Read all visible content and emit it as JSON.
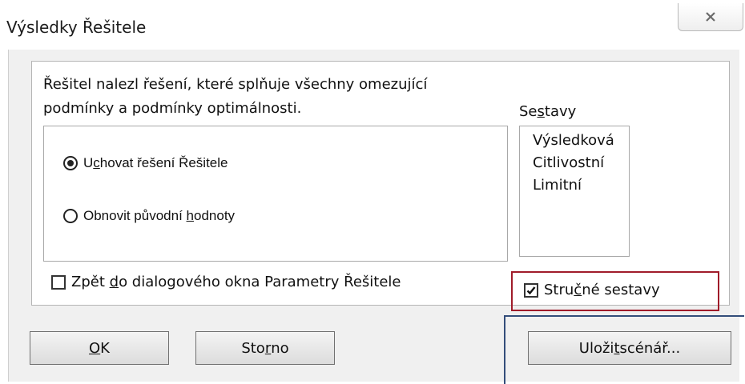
{
  "window": {
    "title": "Výsledky Řešitele"
  },
  "message": {
    "line1": "Řešitel nalezl řešení, které splňuje všechny omezující",
    "line2": "podmínky a podmínky optimálnosti."
  },
  "options": {
    "keep": {
      "pre": "U",
      "mnemonic": "c",
      "post": "hovat řešení Řešitele",
      "selected": true
    },
    "restore": {
      "pre": "Obnovit původní ",
      "mnemonic": "h",
      "post": "odnoty",
      "selected": false
    }
  },
  "reports": {
    "label_pre": "Se",
    "label_mnemonic": "s",
    "label_post": "tavy",
    "items": [
      "Výsledková",
      "Citlivostní",
      "Limitní"
    ]
  },
  "return_dialog": {
    "pre": "Zpět ",
    "mnemonic": "d",
    "post": "o dialogového okna Parametry Řešitele",
    "checked": false
  },
  "outline_reports": {
    "pre": "Stru",
    "mnemonic": "č",
    "post": "né sestavy",
    "checked": true
  },
  "buttons": {
    "ok": {
      "pre": "",
      "mnemonic": "O",
      "post": "K"
    },
    "cancel": {
      "pre": "Sto",
      "mnemonic": "r",
      "post": "no"
    },
    "save_scenario": {
      "pre": "Uloži",
      "mnemonic": "t",
      "post": " scénář..."
    }
  },
  "highlight_colors": {
    "red": "#a01c2a",
    "blue": "#334d7a"
  }
}
